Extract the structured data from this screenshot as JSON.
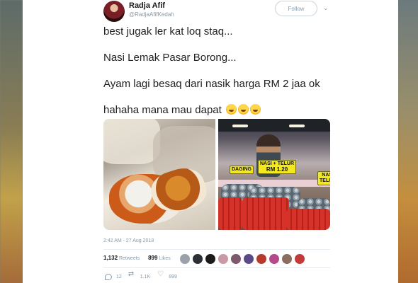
{
  "author": {
    "name": "Radja Afif",
    "handle": "@RadjaAfifKedah",
    "follow_label": "Follow"
  },
  "tweet": {
    "lines": [
      "best jugak ler kat loq staq...",
      "Nasi Lemak Pasar Borong...",
      "Ayam lagi besaq dari nasik harga RM 2 jaa ok",
      "hahaha mana mau dapat"
    ],
    "emoji": "face-with-tears-of-joy",
    "emoji_count": 3,
    "timestamp": "2:42 AM - 27 Aug 2018"
  },
  "media": {
    "sign_left": "DAGING",
    "sign_center_top": "NASI + TELUR",
    "sign_center_price": "RM 1.20",
    "sign_right_top": "NASI",
    "sign_right_bottom": "TELUR"
  },
  "stats": {
    "retweets_count": "1,132",
    "retweets_label": "Retweets",
    "likes_count": "899",
    "likes_label": "Likes",
    "liker_avatar_colors": [
      "#9aa1ab",
      "#2b2f36",
      "#1b1b1b",
      "#c79aa5",
      "#7d5a6d",
      "#5b4a88",
      "#b43b2e",
      "#b44a8a",
      "#8a6f61",
      "#c23b3b"
    ]
  },
  "actions": {
    "replies": "12",
    "retweets": "1.1K",
    "likes": "899"
  },
  "colors": {
    "muted": "#8899a6",
    "text": "#14171a",
    "sign_yellow": "#f4e91e"
  }
}
